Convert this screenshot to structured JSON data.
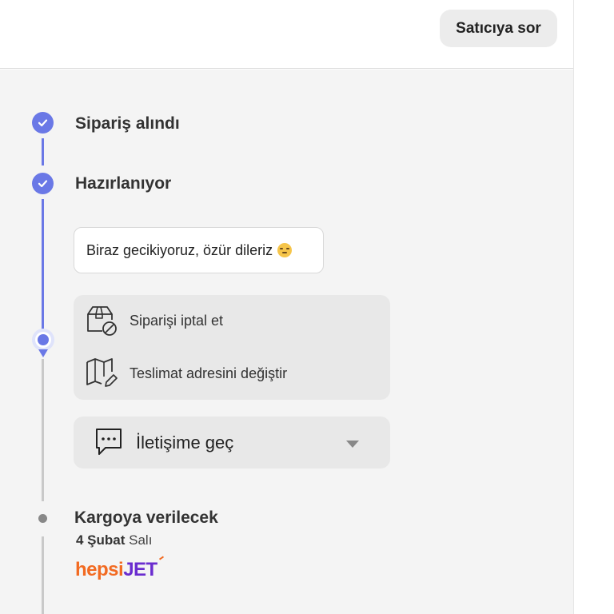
{
  "header": {
    "ask_seller_label": "Satıcıya sor"
  },
  "timeline": {
    "steps": [
      {
        "title": "Sipariş alındı",
        "status": "done"
      },
      {
        "title": "Hazırlanıyor",
        "status": "done"
      }
    ],
    "delay_message": "Biraz gecikiyoruz, özür dileriz",
    "actions": [
      {
        "label": "Siparişi iptal et",
        "icon": "box-cancel-icon"
      },
      {
        "label": "Teslimat adresini değiştir",
        "icon": "map-edit-icon"
      }
    ],
    "contact": {
      "label": "İletişime geç",
      "icon": "chat-bubble-icon"
    },
    "shipping": {
      "title": "Kargoya verilecek",
      "date": "4 Şubat",
      "weekday": "Salı",
      "carrier_part1": "hepsi",
      "carrier_part2": "JET"
    }
  },
  "colors": {
    "accent": "#6a78e6",
    "carrier_orange": "#f26a21",
    "carrier_purple": "#6a2ccf"
  }
}
